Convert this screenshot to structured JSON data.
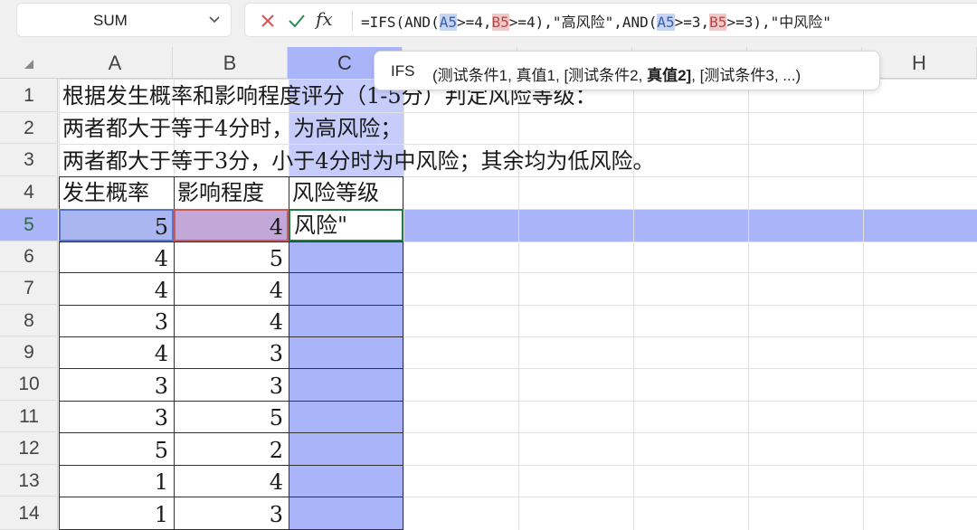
{
  "formula_bar": {
    "name_box": "SUM",
    "formula_parts": [
      "=IFS(AND(",
      "A5",
      ">=4,",
      "B5",
      ">=4),\"高风险\",AND(",
      "A5",
      ">=3,",
      "B5",
      ">=3),\"中风险\""
    ]
  },
  "tooltip": {
    "function": "IFS",
    "args_prefix": "(测试条件1, 真值1, [测试条件2, ",
    "args_bold": "真值2]",
    "args_suffix": ", [测试条件3, ...)"
  },
  "columns": [
    "A",
    "B",
    "C",
    "",
    "",
    "",
    "",
    "H"
  ],
  "rows": [
    "1",
    "2",
    "3",
    "4",
    "5",
    "6",
    "7",
    "8",
    "9",
    "10",
    "11",
    "12",
    "13",
    "14"
  ],
  "notes": [
    "根据发生概率和影响程度评分（1-5分）判定风险等级：",
    "两者都大于等于4分时，为高风险；",
    "两者都大于等于3分，小于4分时为中风险；其余均为低风险。"
  ],
  "table": {
    "headers": [
      "发生概率",
      "影响程度",
      "风险等级"
    ],
    "active_cell_text": "风险\"",
    "data": [
      [
        5,
        4
      ],
      [
        4,
        5
      ],
      [
        4,
        4
      ],
      [
        3,
        4
      ],
      [
        4,
        3
      ],
      [
        3,
        3
      ],
      [
        3,
        5
      ],
      [
        5,
        2
      ],
      [
        1,
        4
      ],
      [
        1,
        3
      ]
    ]
  },
  "colors": {
    "selection_fill": "#aab4f8",
    "selected_row": "#aab4f8",
    "ref_a_fill": "#a9b6ef",
    "ref_b_fill": "#c3a7d9",
    "active_border": "#1f7a43"
  }
}
